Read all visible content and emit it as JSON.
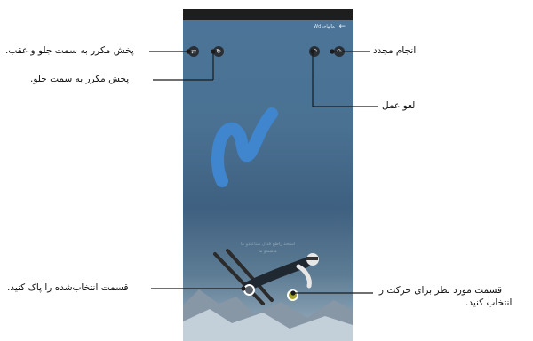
{
  "screen": {
    "title": "Wd ےاﻟﮭﺎﺧﺑ",
    "back_icon": "back-arrow-icon",
    "hint_line1": "ﺍﺳﺘﺨﺪ ﮊﺍﻃﺢ ﻓﺪﺍﻝ ﺳﻨﺎﻋﺘﺪﻭ ﻣﺎ",
    "hint_line2": "ﻣﺎﺳﺘﺪﻭ ﻣﺎ"
  },
  "callouts": {
    "redo": "انجام مجدد",
    "undo": "لغو عمل",
    "repeat_forward_backward": "پخش مکرر به سمت جلو و عقب.",
    "repeat_forward": "پخش مکرر به سمت جلو.",
    "clear_selection": "قسمت انتخاب‌شده را پاک کنید.",
    "select_move_line1": "قسمت مورد نظر برای حرکت را",
    "select_move_line2": "انتخاب کنید."
  },
  "icons": {
    "redo": "redo-icon",
    "undo": "undo-icon",
    "repeat_forward_backward": "repeat-forward-backward-icon",
    "repeat_forward": "repeat-forward-icon",
    "clear_selection": "clear-selection-point",
    "select_move": "select-move-point"
  },
  "colors": {
    "brush_stroke": "#3f86cf",
    "sky": "#4a7192",
    "status_bar": "#1e1e1e",
    "clear_point": "#5a6068",
    "select_point": "#a7a52a"
  }
}
